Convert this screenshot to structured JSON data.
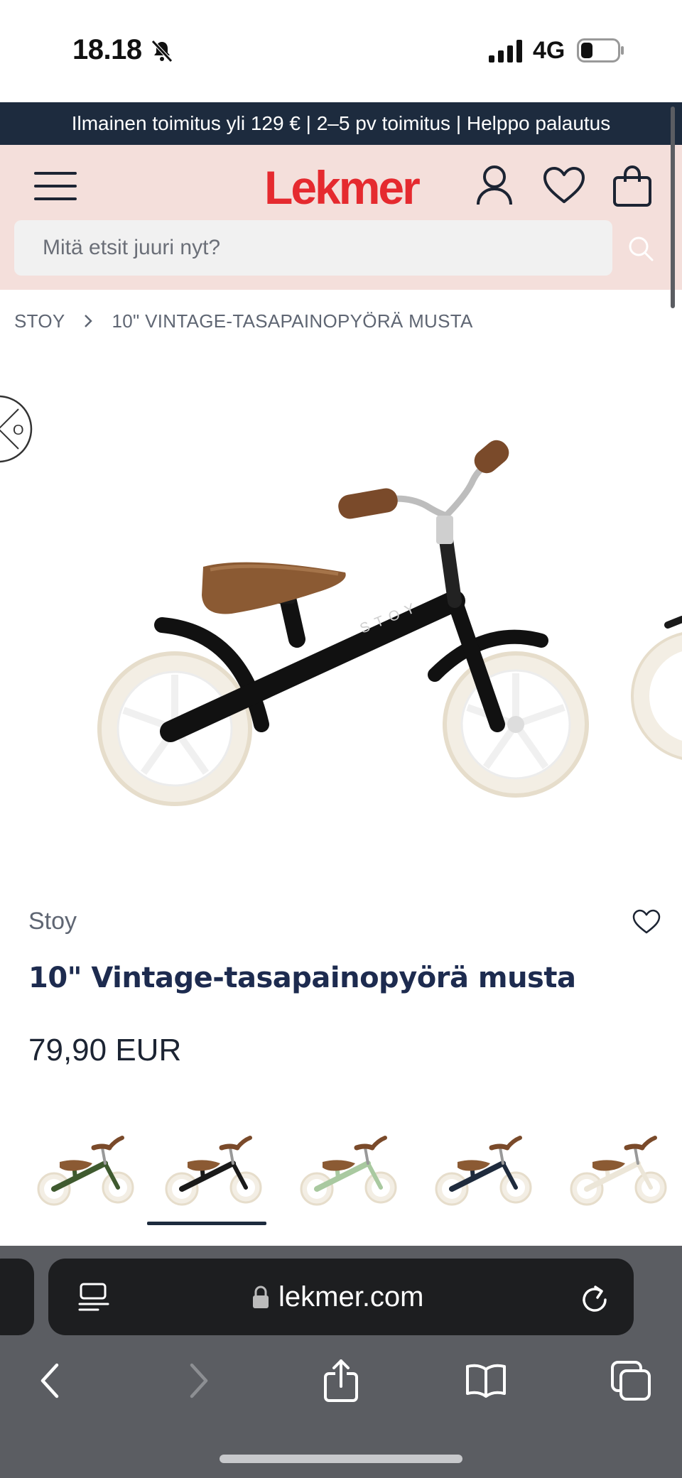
{
  "status_bar": {
    "time": "18.18",
    "network": "4G"
  },
  "promo_banner": {
    "text": "Ilmainen toimitus yli 129 € | 2–5 pv toimitus | Helppo palautus"
  },
  "header": {
    "logo": "Lekmer",
    "search_placeholder": "Mitä etsit juuri nyt?"
  },
  "breadcrumb": {
    "items": [
      "STOY",
      "10\" VINTAGE-TASAPAINOPYÖRÄ MUSTA"
    ]
  },
  "product": {
    "brand": "Stoy",
    "title": "10\" Vintage-tasapainopyörä musta",
    "price": "79,90 EUR",
    "frame_logo": "STOY",
    "variants": [
      {
        "color_name": "green",
        "color": "#3f5a2f"
      },
      {
        "color_name": "black",
        "color": "#1a1a1a"
      },
      {
        "color_name": "mint",
        "color": "#a9c9a0"
      },
      {
        "color_name": "navy",
        "color": "#1f2b3d"
      },
      {
        "color_name": "cream",
        "color": "#ece6d8"
      }
    ],
    "selected_variant": 1
  },
  "browser": {
    "url": "lekmer.com"
  },
  "colors": {
    "promo_bg": "#1d2b3e",
    "header_bg": "#f4dfdb",
    "brand_red": "#e52a2f",
    "title_navy": "#1d2b4f"
  }
}
